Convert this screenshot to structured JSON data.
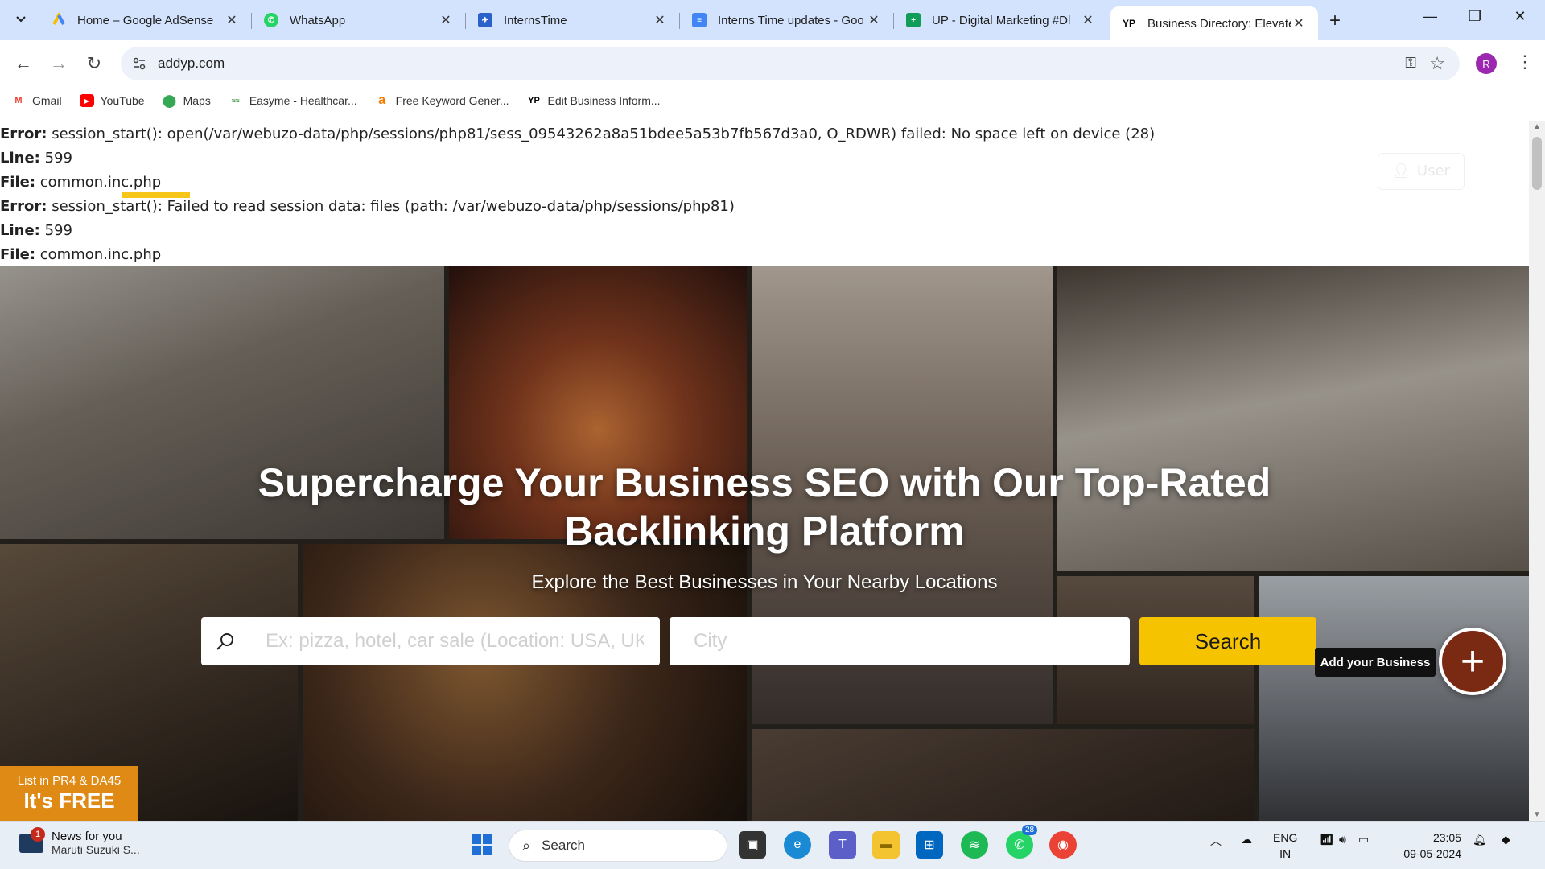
{
  "browser": {
    "tabs": [
      {
        "title": "Home – Google AdSense",
        "icon": "adsense-icon",
        "color": "#4285f4"
      },
      {
        "title": "WhatsApp",
        "icon": "whatsapp-icon",
        "color": "#25d366"
      },
      {
        "title": "InternsTime",
        "icon": "internstime-icon",
        "color": "#2a62c9"
      },
      {
        "title": "Interns Time updates - Goo",
        "icon": "google-docs-icon",
        "color": "#4285f4"
      },
      {
        "title": "UP - Digital Marketing #Dl",
        "icon": "google-sheets-icon",
        "color": "#0f9d58"
      },
      {
        "title": "Business Directory: Elevate",
        "icon": "yp-icon",
        "color": "#000000",
        "active": true
      }
    ],
    "address": "addyp.com",
    "profile_initial": "R",
    "bookmarks": [
      {
        "label": "Gmail",
        "icon": "gmail-icon"
      },
      {
        "label": "YouTube",
        "icon": "youtube-icon"
      },
      {
        "label": "Maps",
        "icon": "maps-icon"
      },
      {
        "label": "Easyme - Healthcar...",
        "icon": "easyme-icon"
      },
      {
        "label": "Free Keyword Gener...",
        "icon": "keyword-tool-icon"
      },
      {
        "label": "Edit Business Inform...",
        "icon": "yp-icon"
      }
    ]
  },
  "page": {
    "errors": [
      {
        "label": "Error:",
        "text": " session_start(): open(/var/webuzo-data/php/sessions/php81/sess_09543262a8a51bdee5a53b7fb567d3a0, O_RDWR) failed: No space left on device (28)"
      },
      {
        "label": "Line:",
        "text": " 599"
      },
      {
        "label": "File:",
        "text": " common.inc.php"
      },
      {
        "label": "Error:",
        "text": " session_start(): Failed to read session data: files (path: /var/webuzo-data/php/sessions/php81)"
      },
      {
        "label": "Line:",
        "text": " 599"
      },
      {
        "label": "File:",
        "text": " common.inc.php"
      }
    ],
    "user_button": "User",
    "hero_title": "Supercharge Your Business SEO with Our Top-Rated Backlinking Platform",
    "hero_subtitle": "Explore the Best Businesses in Your Nearby Locations",
    "keyword_placeholder": "Ex: pizza, hotel, car sale (Location: USA, UK,",
    "city_placeholder": "City",
    "search_button": "Search",
    "add_business_label": "Add your Business",
    "add_business_symbol": "+",
    "promo_line1": "List in PR4 & DA45",
    "promo_line2": "It's FREE"
  },
  "taskbar": {
    "news_title": "News for you",
    "news_sub": "Maruti Suzuki S...",
    "news_badge": "1",
    "search_label": "Search",
    "whatsapp_badge": "28",
    "lang_1": "ENG",
    "lang_2": "IN",
    "time": "23:05",
    "date": "09-05-2024"
  }
}
